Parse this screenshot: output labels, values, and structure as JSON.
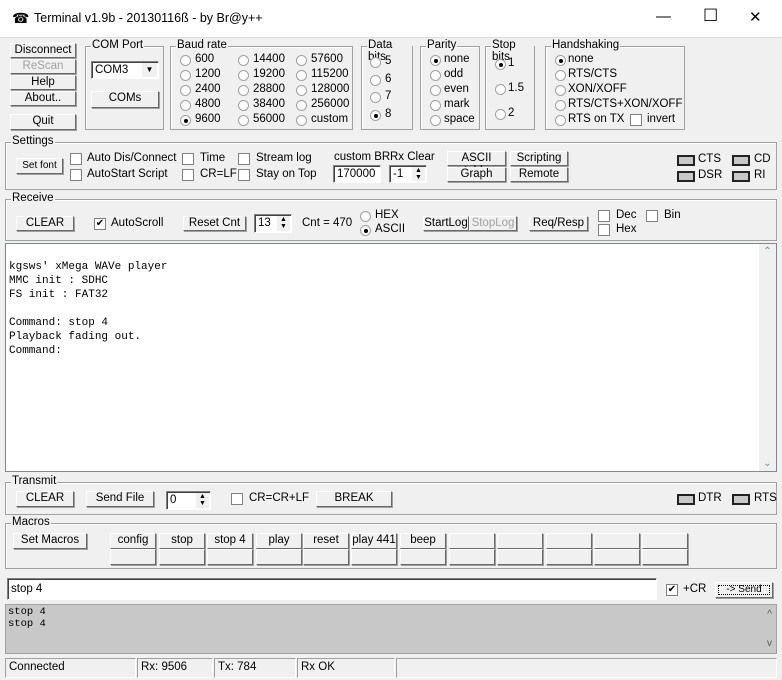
{
  "window": {
    "title": "Terminal v1.9b - 20130116ß - by Br@y++",
    "minimize": "—",
    "maximize": "☐",
    "close": "✕"
  },
  "connection": {
    "disconnect": "Disconnect",
    "rescan": "ReScan",
    "help": "Help",
    "about": "About..",
    "quit": "Quit"
  },
  "com_port": {
    "label": "COM Port",
    "value": "COM3",
    "coms": "COMs"
  },
  "baud": {
    "label": "Baud rate",
    "options": [
      "600",
      "1200",
      "2400",
      "4800",
      "9600",
      "14400",
      "19200",
      "28800",
      "38400",
      "56000",
      "57600",
      "115200",
      "128000",
      "256000",
      "custom"
    ],
    "selected": "9600"
  },
  "data_bits": {
    "label": "Data bits",
    "options": [
      "5",
      "6",
      "7",
      "8"
    ],
    "selected": "8"
  },
  "parity": {
    "label": "Parity",
    "options": [
      "none",
      "odd",
      "even",
      "mark",
      "space"
    ],
    "selected": "none"
  },
  "stop_bits": {
    "label": "Stop bits",
    "options": [
      "1",
      "1.5",
      "2"
    ],
    "selected": "1"
  },
  "handshaking": {
    "label": "Handshaking",
    "options": [
      "none",
      "RTS/CTS",
      "XON/XOFF",
      "RTS/CTS+XON/XOFF",
      "RTS on TX"
    ],
    "selected": "none",
    "invert": "invert"
  },
  "settings": {
    "label": "Settings",
    "set_font": "Set font",
    "auto_dis": "Auto Dis/Connect",
    "autostart": "AutoStart Script",
    "time": "Time",
    "crlf": "CR=LF",
    "stream_log": "Stream log",
    "stay_on_top": "Stay on Top",
    "custom_br_label": "custom BR",
    "custom_br": "170000",
    "rx_clear_label": "Rx Clear",
    "rx_clear": "-1",
    "ascii_table": "ASCII table",
    "scripting": "Scripting",
    "graph": "Graph",
    "remote": "Remote",
    "cts": "CTS",
    "cd": "CD",
    "dsr": "DSR",
    "ri": "RI"
  },
  "receive": {
    "label": "Receive",
    "clear": "CLEAR",
    "autoscroll": "AutoScroll",
    "autoscroll_checked": true,
    "reset_cnt": "Reset Cnt",
    "cnt_spin": "13",
    "cnt_label": "Cnt =",
    "cnt": "470",
    "hex": "HEX",
    "ascii": "ASCII",
    "startlog": "StartLog",
    "stoplog": "StopLog",
    "reqresp": "Req/Resp",
    "dec": "Dec",
    "hexchk": "Hex",
    "bin": "Bin",
    "text": "\nkgsws' xMega WAVe player\nMMC init : SDHC\nFS init : FAT32\n\nCommand: stop 4\nPlayback fading out.\nCommand:"
  },
  "transmit": {
    "label": "Transmit",
    "clear": "CLEAR",
    "send_file": "Send File",
    "spin": "0",
    "crcrlf": "CR=CR+LF",
    "break": "BREAK",
    "dtr": "DTR",
    "rts": "RTS"
  },
  "macros": {
    "label": "Macros",
    "set_macros": "Set Macros",
    "row1": [
      "config",
      "stop",
      "stop 4",
      "play",
      "reset",
      "play 441",
      "beep",
      "",
      "",
      "",
      "",
      ""
    ],
    "row2": [
      "",
      "",
      "",
      "",
      "",
      "",
      "",
      "",
      "",
      "",
      "",
      ""
    ]
  },
  "input": {
    "value": "stop 4",
    "cr_label": "+CR",
    "cr_checked": true,
    "send": "-> Send"
  },
  "tx_log": "stop 4\nstop 4",
  "status": {
    "state": "Connected",
    "rx": "Rx: 9506",
    "tx": "Tx: 784",
    "rx_ok": "Rx OK"
  }
}
